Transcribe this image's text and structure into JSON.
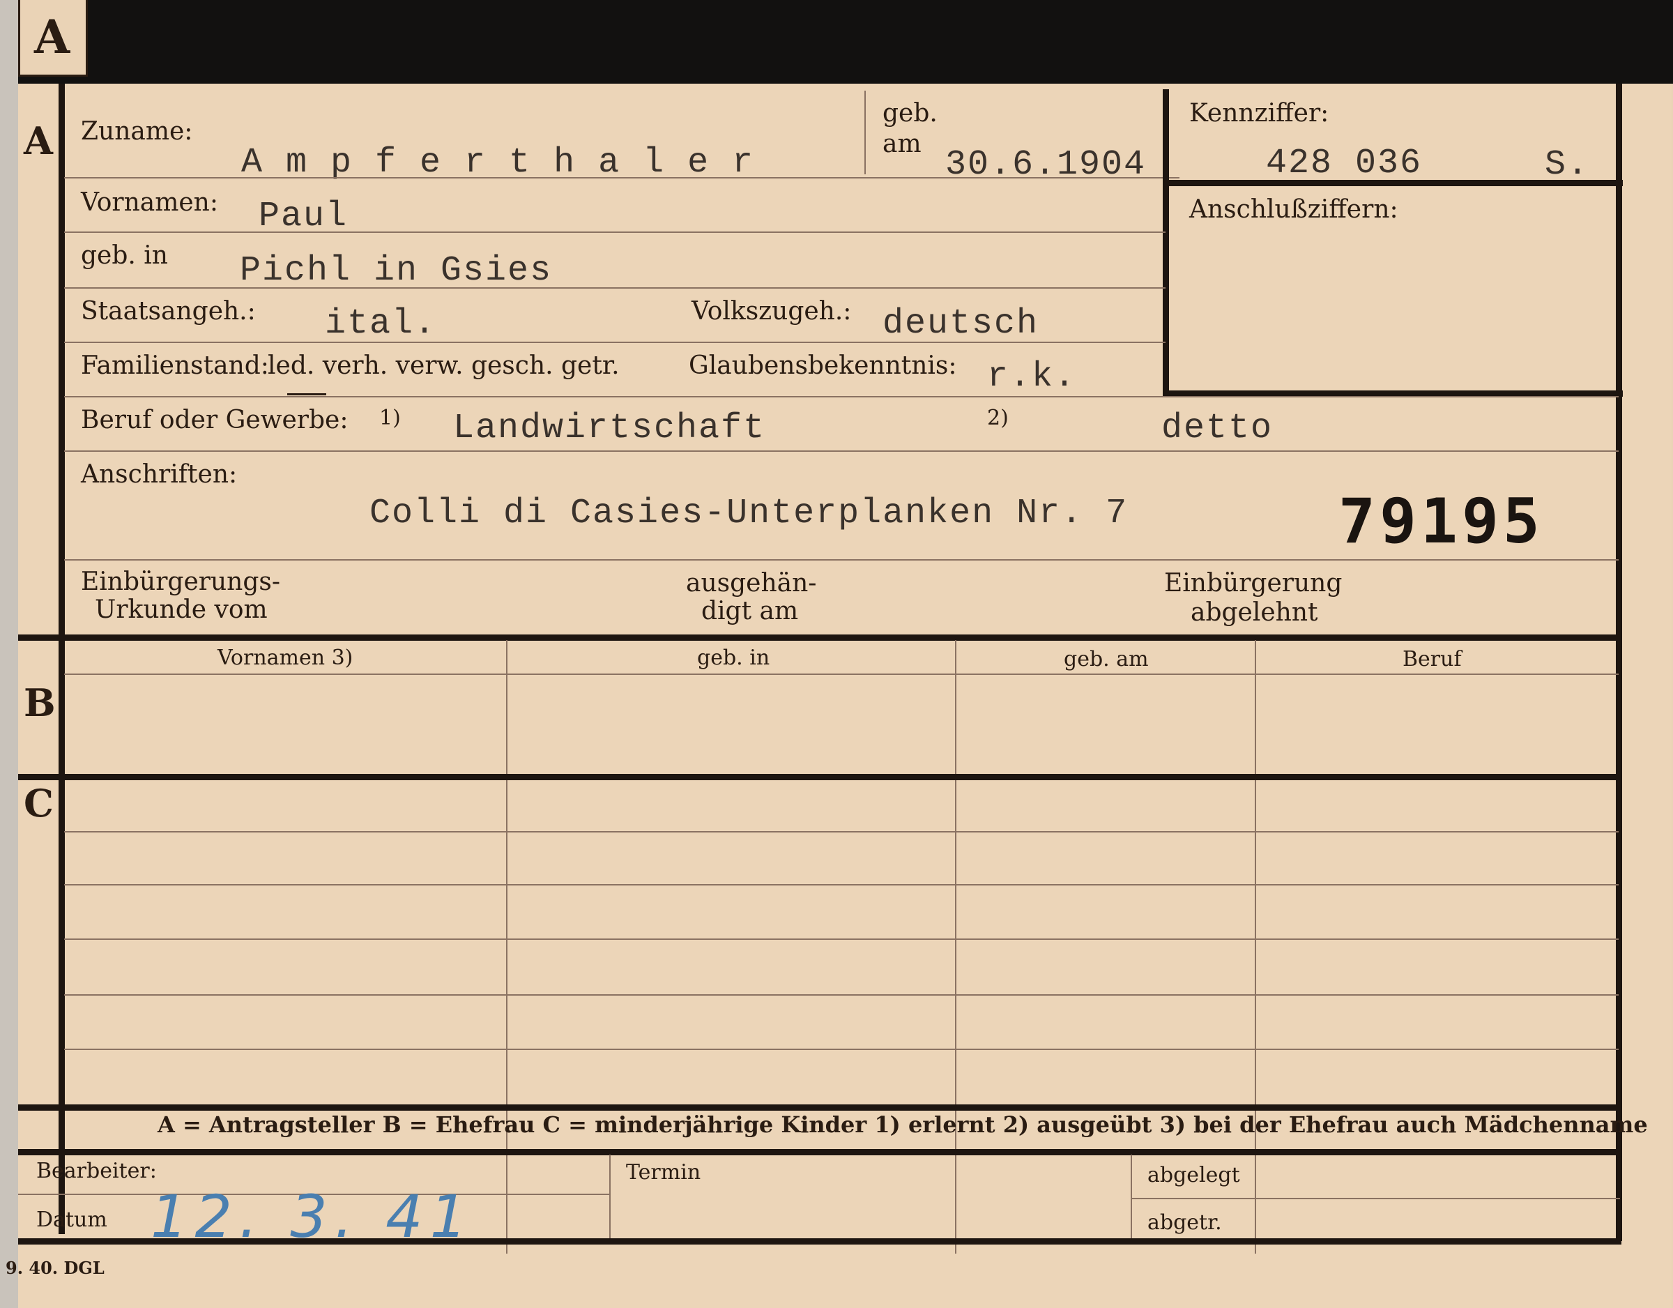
{
  "tab_letter": "A",
  "section_a": {
    "letter": "A",
    "zuname_label": "Zuname:",
    "zuname_value": "A m p f e r t h a l e r",
    "geb_label_line1": "geb.",
    "geb_label_line2": "am",
    "geb_am_value": "30.6.1904",
    "kennziffer_label": "Kennziffer:",
    "kennziffer_value": "428 036",
    "kennziffer_suffix": "S.",
    "anschlussziffern_label": "Anschlußziffern:",
    "vornamen_label": "Vornamen:",
    "vornamen_value": "Paul",
    "geb_in_label": "geb. in",
    "geb_in_value": "Pichl in Gsies",
    "staatsangeh_label": "Staatsangeh.:",
    "staatsangeh_value": "ital.",
    "volkszugeh_label": "Volkszugeh.:",
    "volkszugeh_value": "deutsch",
    "familienstand_label": "Familienstand:",
    "familienstand_options": "led. verh. verw. gesch. getr.",
    "glaubensbekenntnis_label": "Glaubensbekenntnis:",
    "glaubensbekenntnis_value": "r.k.",
    "beruf_label": "Beruf oder Gewerbe:",
    "beruf_note1": "1)",
    "beruf_value1": "Landwirtschaft",
    "beruf_note2": "2)",
    "beruf_value2": "detto",
    "anschriften_label": "Anschriften:",
    "anschriften_value": "Colli di Casies-Unterplanken Nr. 7",
    "stamp_number": "79195",
    "einbuergerung_urkunde_line1": "Einbürgerungs-",
    "einbuergerung_urkunde_line2": "Urkunde vom",
    "ausgehaendigt_line1": "ausgehän-",
    "ausgehaendigt_line2": "digt am",
    "einbuergerung_abgelehnt_line1": "Einbürgerung",
    "einbuergerung_abgelehnt_line2": "abgelehnt"
  },
  "section_b": {
    "letter": "B",
    "columns": [
      "Vornamen 3)",
      "geb. in",
      "geb. am",
      "Beruf"
    ]
  },
  "section_c": {
    "letter": "C"
  },
  "legend": "A = Antragsteller   B = Ehefrau   C = minderjährige Kinder   1) erlernt   2) ausgeübt   3) bei der Ehefrau auch Mädchenname",
  "bottom": {
    "bearbeiter_label": "Bearbeiter:",
    "datum_label": "Datum",
    "datum_value": "12. 3. 41",
    "termin_label": "Termin",
    "abgelegt_label": "abgelegt",
    "abgetr_label": "abgetr."
  },
  "footer_code": "9. 40. DGL"
}
